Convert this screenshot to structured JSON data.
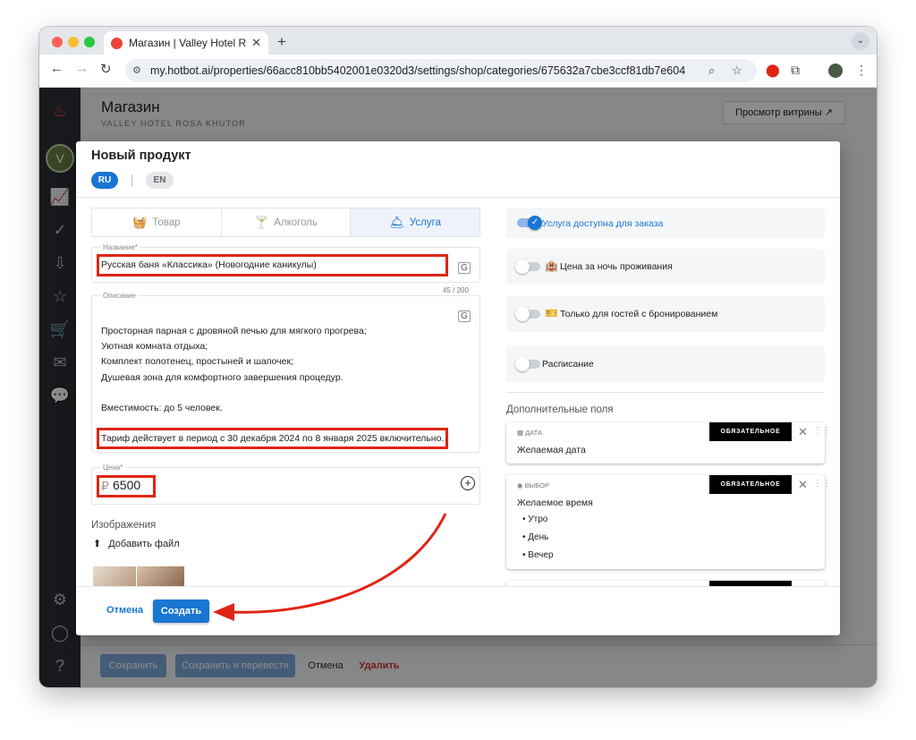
{
  "browser": {
    "tab_title": "Магазин | Valley Hotel Rosa K",
    "url": "my.hotbot.ai/properties/66acc810bb5402001e0320d3/settings/shop/categories/675632a7cbe3ccf81db7e604"
  },
  "page": {
    "title": "Магазин",
    "subtitle": "VALLEY HOTEL ROSA KHUTOR",
    "preview_label": "Просмотр витрины ↗",
    "save": "Сохранить",
    "save_translate": "Сохранить и перевести",
    "cancel": "Отмена",
    "delete": "Удалить"
  },
  "modal": {
    "title": "Новый продукт",
    "lang_ru": "RU",
    "lang_en": "EN",
    "tabs": [
      {
        "label": "Товар"
      },
      {
        "label": "Алкоголь"
      },
      {
        "label": "Услуга"
      }
    ],
    "name_label": "Название*",
    "name_value": "Русская баня «Классика» (Новогодние каникулы)",
    "counter": "45 / 200",
    "desc_label": "Описание",
    "desc_lines": [
      "Просторная парная с дровяной печью для мягкого прогрева;",
      "Уютная комната отдыха;",
      "Комплект полотенец, простыней и шапочек;",
      "Душевая зона для комфортного завершения процедур.",
      "",
      "Вместимость: до 5 человек.",
      "",
      "Тариф действует в период с 30 декабря 2024 по 8 января 2025 включительно."
    ],
    "price_label": "Цена*",
    "currency": "₽",
    "price_value": "6500",
    "images_label": "Изображения",
    "add_file": "Добавить файл",
    "options": {
      "available": "Услуга доступна для заказа",
      "per_night": "Цена за ночь проживания",
      "guests_only": "Только для гостей с бронированием",
      "schedule": "Расписание"
    },
    "extra_label": "Дополнительные поля",
    "fields": [
      {
        "type": "Дата",
        "name": "Желаемая дата",
        "badge": "ОБЯЗАТЕЛЬНОЕ ПОЛЕ"
      },
      {
        "type": "Выбор",
        "name": "Желаемое время",
        "badge": "ОБЯЗАТЕЛЬНОЕ ПОЛЕ",
        "choices": [
          "Утро",
          "День",
          "Вечер"
        ]
      }
    ],
    "cancel": "Отмена",
    "create": "Создать"
  },
  "colors": {
    "accent": "#1976d2",
    "annotation": "#e02514",
    "sidebar": "#2b2f36"
  }
}
